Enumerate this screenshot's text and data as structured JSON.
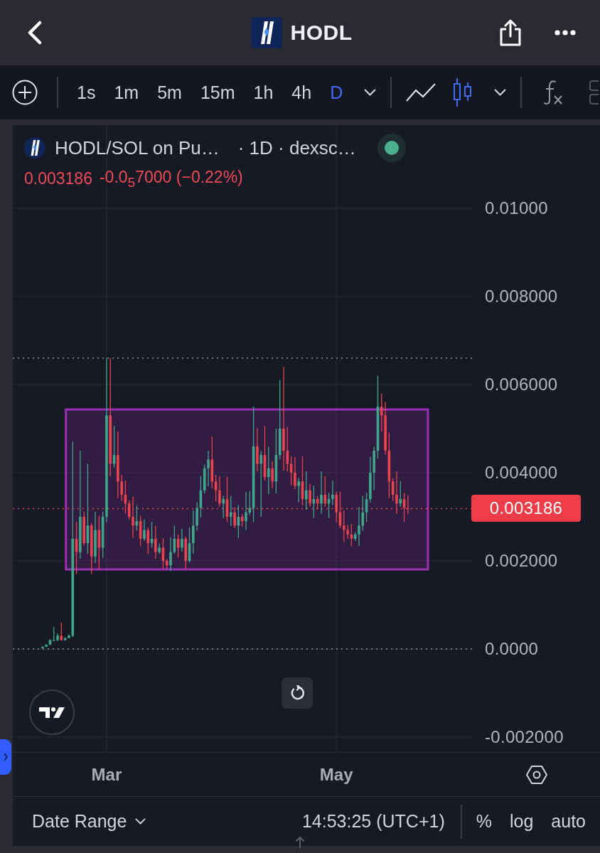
{
  "header": {
    "title": "HODL"
  },
  "toolbar": {
    "intervals": [
      {
        "label": "1s",
        "selected": false
      },
      {
        "label": "1m",
        "selected": false
      },
      {
        "label": "5m",
        "selected": false
      },
      {
        "label": "15m",
        "selected": false
      },
      {
        "label": "1h",
        "selected": false
      },
      {
        "label": "4h",
        "selected": false
      },
      {
        "label": "D",
        "selected": true
      }
    ],
    "chart_styles": [
      {
        "kind": "line",
        "selected": false
      },
      {
        "kind": "candles",
        "selected": true
      }
    ]
  },
  "chart": {
    "legend": {
      "symbol": "HODL/SOL on Pu…",
      "details": "· 1D · dexsc…",
      "last": "0.003186",
      "change": "-0.0$_{5}$7000 (−0.22%)"
    },
    "last_price": "0.003186",
    "chart_data": {
      "type": "candlestick",
      "categories": [
        null,
        null,
        null,
        null,
        null,
        null,
        null,
        null,
        null,
        null,
        null,
        null,
        null,
        null,
        null,
        null,
        null,
        "Mar",
        null,
        null,
        null,
        null,
        null,
        null,
        null,
        null,
        null,
        null,
        null,
        null,
        null,
        null,
        null,
        null,
        null,
        null,
        null,
        null,
        null,
        null,
        null,
        null,
        null,
        null,
        null,
        null,
        null,
        null,
        null,
        null,
        null,
        null,
        null,
        null,
        null,
        null,
        null,
        null,
        null,
        null,
        null,
        null,
        null,
        null,
        null,
        null,
        null,
        null,
        null,
        null,
        null,
        null,
        null,
        null,
        null,
        null,
        null,
        null,
        "May",
        null,
        null,
        null,
        null,
        null,
        null,
        null,
        null,
        null,
        null,
        null,
        null,
        null,
        null,
        null,
        null,
        null,
        null,
        null
      ],
      "ohlc": [
        [
          2e-05,
          6e-05,
          2e-05,
          5e-05
        ],
        [
          5e-05,
          0.0001,
          5e-05,
          0.0001
        ],
        [
          0.0001,
          0.00022,
          9e-05,
          0.0002
        ],
        [
          0.0002,
          0.0005,
          0.0002,
          0.0002
        ],
        [
          0.0002,
          0.00035,
          0.00018,
          0.0003
        ],
        [
          0.0003,
          0.0006,
          0.00019,
          0.0002
        ],
        [
          0.0002,
          0.00026,
          0.00019,
          0.00025
        ],
        [
          0.00025,
          0.00033,
          0.00025,
          0.0003
        ],
        [
          0.0003,
          0.0047,
          0.00027,
          0.0025
        ],
        [
          0.0025,
          0.00288,
          0.0017,
          0.0022
        ],
        [
          0.0022,
          0.0045,
          0.00205,
          0.003
        ],
        [
          0.003,
          0.00312,
          0.00235,
          0.0024
        ],
        [
          0.0024,
          0.0042,
          0.00216,
          0.0028
        ],
        [
          0.0028,
          0.00286,
          0.0017,
          0.0021
        ],
        [
          0.0021,
          0.00311,
          0.00195,
          0.0027
        ],
        [
          0.0027,
          0.00302,
          0.0018,
          0.0023
        ],
        [
          0.0023,
          0.00312,
          0.00207,
          0.003
        ],
        [
          0.003,
          0.0066,
          0.00288,
          0.0053
        ],
        [
          0.0053,
          0.0066,
          0.00391,
          0.0042
        ],
        [
          0.0042,
          0.00506,
          0.00412,
          0.0044
        ],
        [
          0.0044,
          0.00493,
          0.00342,
          0.0038
        ],
        [
          0.0038,
          0.00395,
          0.00336,
          0.0035
        ],
        [
          0.0035,
          0.00382,
          0.00307,
          0.0033
        ],
        [
          0.0033,
          0.00337,
          0.00294,
          0.003
        ],
        [
          0.003,
          0.00345,
          0.00252,
          0.0028
        ],
        [
          0.0028,
          0.00325,
          0.00269,
          0.0029
        ],
        [
          0.0029,
          0.00302,
          0.00233,
          0.0025
        ],
        [
          0.0025,
          0.00294,
          0.00245,
          0.0027
        ],
        [
          0.0027,
          0.00275,
          0.00216,
          0.0024
        ],
        [
          0.0024,
          0.00288,
          0.0023,
          0.0025
        ],
        [
          0.0025,
          0.0028,
          0.00205,
          0.0022
        ],
        [
          0.0022,
          0.00239,
          0.00216,
          0.0023
        ],
        [
          0.0023,
          0.00251,
          0.0018,
          0.002
        ],
        [
          0.002,
          0.00204,
          0.00182,
          0.0019
        ],
        [
          0.0019,
          0.00253,
          0.00177,
          0.0022
        ],
        [
          0.0022,
          0.0028,
          0.00216,
          0.0025
        ],
        [
          0.0025,
          0.0026,
          0.00207,
          0.0023
        ],
        [
          0.0023,
          0.00273,
          0.00221,
          0.0025
        ],
        [
          0.0025,
          0.00255,
          0.0018,
          0.002
        ],
        [
          0.002,
          0.00276,
          0.00196,
          0.0024
        ],
        [
          0.0024,
          0.00314,
          0.00216,
          0.0028
        ],
        [
          0.0028,
          0.00333,
          0.00269,
          0.0032
        ],
        [
          0.0032,
          0.00392,
          0.00298,
          0.0036
        ],
        [
          0.0036,
          0.00418,
          0.00353,
          0.0041
        ],
        [
          0.0041,
          0.0045,
          0.00369,
          0.0043
        ],
        [
          0.0043,
          0.00482,
          0.00365,
          0.0038
        ],
        [
          0.0038,
          0.00395,
          0.00335,
          0.0036
        ],
        [
          0.0036,
          0.00392,
          0.00323,
          0.0033
        ],
        [
          0.0033,
          0.00347,
          0.00297,
          0.0034
        ],
        [
          0.0034,
          0.00391,
          0.00288,
          0.003
        ],
        [
          0.003,
          0.00347,
          0.00279,
          0.0031
        ],
        [
          0.0031,
          0.00322,
          0.00274,
          0.0028
        ],
        [
          0.0028,
          0.00327,
          0.00252,
          0.003
        ],
        [
          0.003,
          0.00306,
          0.00278,
          0.0029
        ],
        [
          0.0029,
          0.00357,
          0.0027,
          0.0031
        ],
        [
          0.0031,
          0.00358,
          0.00304,
          0.0032
        ],
        [
          0.0032,
          0.0055,
          0.00288,
          0.0046
        ],
        [
          0.0046,
          0.00501,
          0.00403,
          0.0042
        ],
        [
          0.0042,
          0.00449,
          0.003,
          0.0044
        ],
        [
          0.0044,
          0.00506,
          0.00382,
          0.0039
        ],
        [
          0.0039,
          0.00459,
          0.00351,
          0.0041
        ],
        [
          0.0041,
          0.00426,
          0.00365,
          0.0038
        ],
        [
          0.0038,
          0.005,
          0.00353,
          0.0044
        ],
        [
          0.0044,
          0.0061,
          0.00431,
          0.005
        ],
        [
          0.005,
          0.0064,
          0.00405,
          0.0045
        ],
        [
          0.0045,
          0.00504,
          0.00403,
          0.0042
        ],
        [
          0.0042,
          0.00437,
          0.00372,
          0.004
        ],
        [
          0.004,
          0.00436,
          0.00363,
          0.0037
        ],
        [
          0.0037,
          0.00388,
          0.00333,
          0.0038
        ],
        [
          0.0038,
          0.00437,
          0.00326,
          0.0034
        ],
        [
          0.0034,
          0.00403,
          0.00316,
          0.0036
        ],
        [
          0.0036,
          0.00374,
          0.00323,
          0.0033
        ],
        [
          0.0033,
          0.00371,
          0.00297,
          0.0034
        ],
        [
          0.0034,
          0.00347,
          0.00317,
          0.0033
        ],
        [
          0.0033,
          0.00403,
          0.00307,
          0.0035
        ],
        [
          0.0035,
          0.00392,
          0.00323,
          0.0033
        ],
        [
          0.0033,
          0.00354,
          0.00297,
          0.0034
        ],
        [
          0.0034,
          0.00382,
          0.00326,
          0.0035
        ],
        [
          0.0035,
          0.00357,
          0.00288,
          0.0031
        ],
        [
          0.0031,
          0.00357,
          0.00274,
          0.0028
        ],
        [
          0.0028,
          0.00314,
          0.00243,
          0.0027
        ],
        [
          0.0027,
          0.00281,
          0.0025,
          0.0026
        ],
        [
          0.0026,
          0.00283,
          0.00233,
          0.0025
        ],
        [
          0.0025,
          0.00265,
          0.00245,
          0.0026
        ],
        [
          0.0026,
          0.00322,
          0.00234,
          0.0028
        ],
        [
          0.0028,
          0.00347,
          0.00269,
          0.0031
        ],
        [
          0.0031,
          0.00354,
          0.00288,
          0.0034
        ],
        [
          0.0034,
          0.00436,
          0.00333,
          0.004
        ],
        [
          0.004,
          0.00459,
          0.0036,
          0.0045
        ],
        [
          0.0045,
          0.0062,
          0.00432,
          0.0055
        ],
        [
          0.0055,
          0.0058,
          0.00493,
          0.0053
        ],
        [
          0.0053,
          0.0056,
          0.00441,
          0.0045
        ],
        [
          0.0045,
          0.00491,
          0.00342,
          0.0038
        ],
        [
          0.0038,
          0.00388,
          0.00336,
          0.0035
        ],
        [
          0.0035,
          0.00403,
          0.00307,
          0.0033
        ],
        [
          0.0033,
          0.00381,
          0.00323,
          0.0034
        ],
        [
          0.0034,
          0.00354,
          0.00288,
          0.0032
        ],
        [
          0.0032,
          0.00349,
          0.00306,
          0.003186
        ]
      ],
      "ylim": [
        -0.002339,
        0.011887
      ],
      "yticks": [
        {
          "value": 0.01,
          "label": "0.01000"
        },
        {
          "value": 0.008,
          "label": "0.008000"
        },
        {
          "value": 0.006,
          "label": "0.006000"
        },
        {
          "value": 0.004,
          "label": "0.004000"
        },
        {
          "value": 0.002,
          "label": "0.002000"
        },
        {
          "value": 0,
          "label": "0.0000"
        },
        {
          "value": -0.002,
          "label": "-0.002000"
        }
      ],
      "grid": true,
      "ref_lines": [
        {
          "axis": "y",
          "value": 0.0066,
          "color": "#8a8d96"
        },
        {
          "axis": "y",
          "value": 0,
          "color": "#8a8d96"
        },
        {
          "axis": "y",
          "value": 0.003186,
          "color": "#e8434f"
        }
      ]
    }
  },
  "bottom_bar": {
    "date_range": "Date Range",
    "time": "14:53:25 (UTC+1)",
    "scale_options": [
      "%",
      "log",
      "auto"
    ]
  }
}
